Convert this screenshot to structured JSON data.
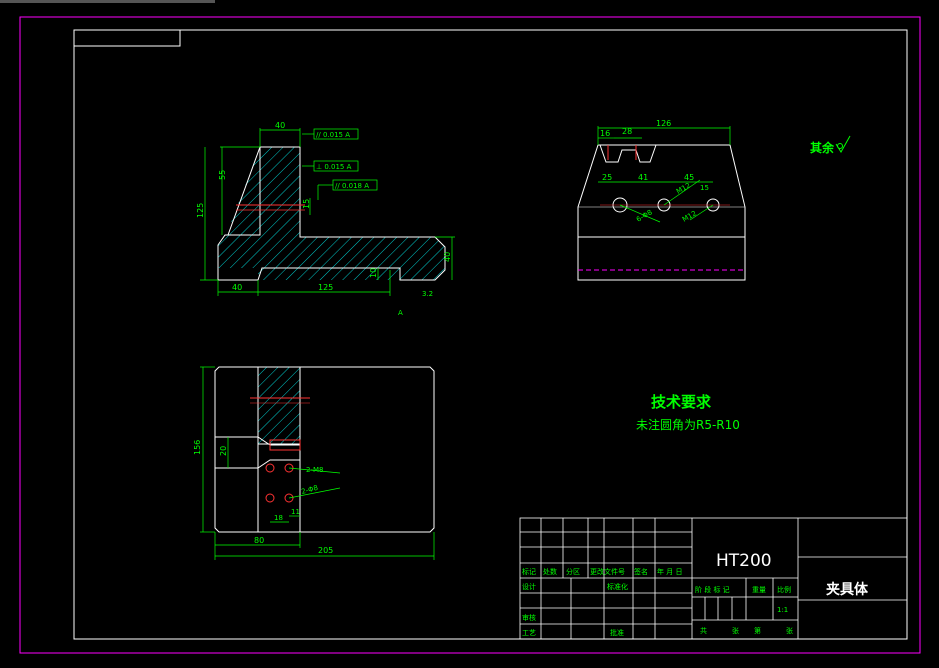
{
  "colors": {
    "background": "#000000",
    "frame": "#ff00ff",
    "lines": "#ffffff",
    "dims": "#00ff00",
    "center": "#ff0000"
  },
  "front_view": {
    "dims": {
      "d40_top": "40",
      "d55": "55",
      "d125_left": "125",
      "d40_bottom": "40",
      "d125_bottom": "125",
      "d10": "10",
      "d15": "15",
      "d40_right": "40"
    },
    "tolerances": [
      "// 0.015 A",
      "⊥ 0.015 A",
      "// 0.018 A"
    ],
    "datum": "A",
    "roughness": "3.2"
  },
  "side_view": {
    "dims": {
      "d126": "126",
      "d16": "16",
      "d28": "28",
      "d25": "25",
      "d41": "41",
      "d45": "45",
      "d15": "15"
    },
    "callouts": [
      "M12",
      "M12",
      "6-Φ8"
    ]
  },
  "top_view": {
    "dims": {
      "d156": "156",
      "d20": "20",
      "d80": "80",
      "d205": "205",
      "d18": "18",
      "d11": "11"
    },
    "callouts": [
      "2-M8",
      "2-Φ8"
    ]
  },
  "surface_note": "其余",
  "tech_req": {
    "title": "技术要求",
    "note": "未注圆角为R5-R10"
  },
  "title_block": {
    "material": "HT200",
    "part_name": "夹具体",
    "scale": "1:1",
    "row_labels": [
      "标记",
      "处数",
      "分区",
      "更改文件号",
      "签名",
      "年 月 日"
    ],
    "left_labels": [
      "设计",
      "审核",
      "工艺"
    ],
    "mid_labels": [
      "标准化",
      "批准"
    ],
    "stage_labels": [
      "阶 段 标 记",
      "重量",
      "比例"
    ],
    "sheet_labels": [
      "共",
      "张",
      "第",
      "张"
    ]
  }
}
